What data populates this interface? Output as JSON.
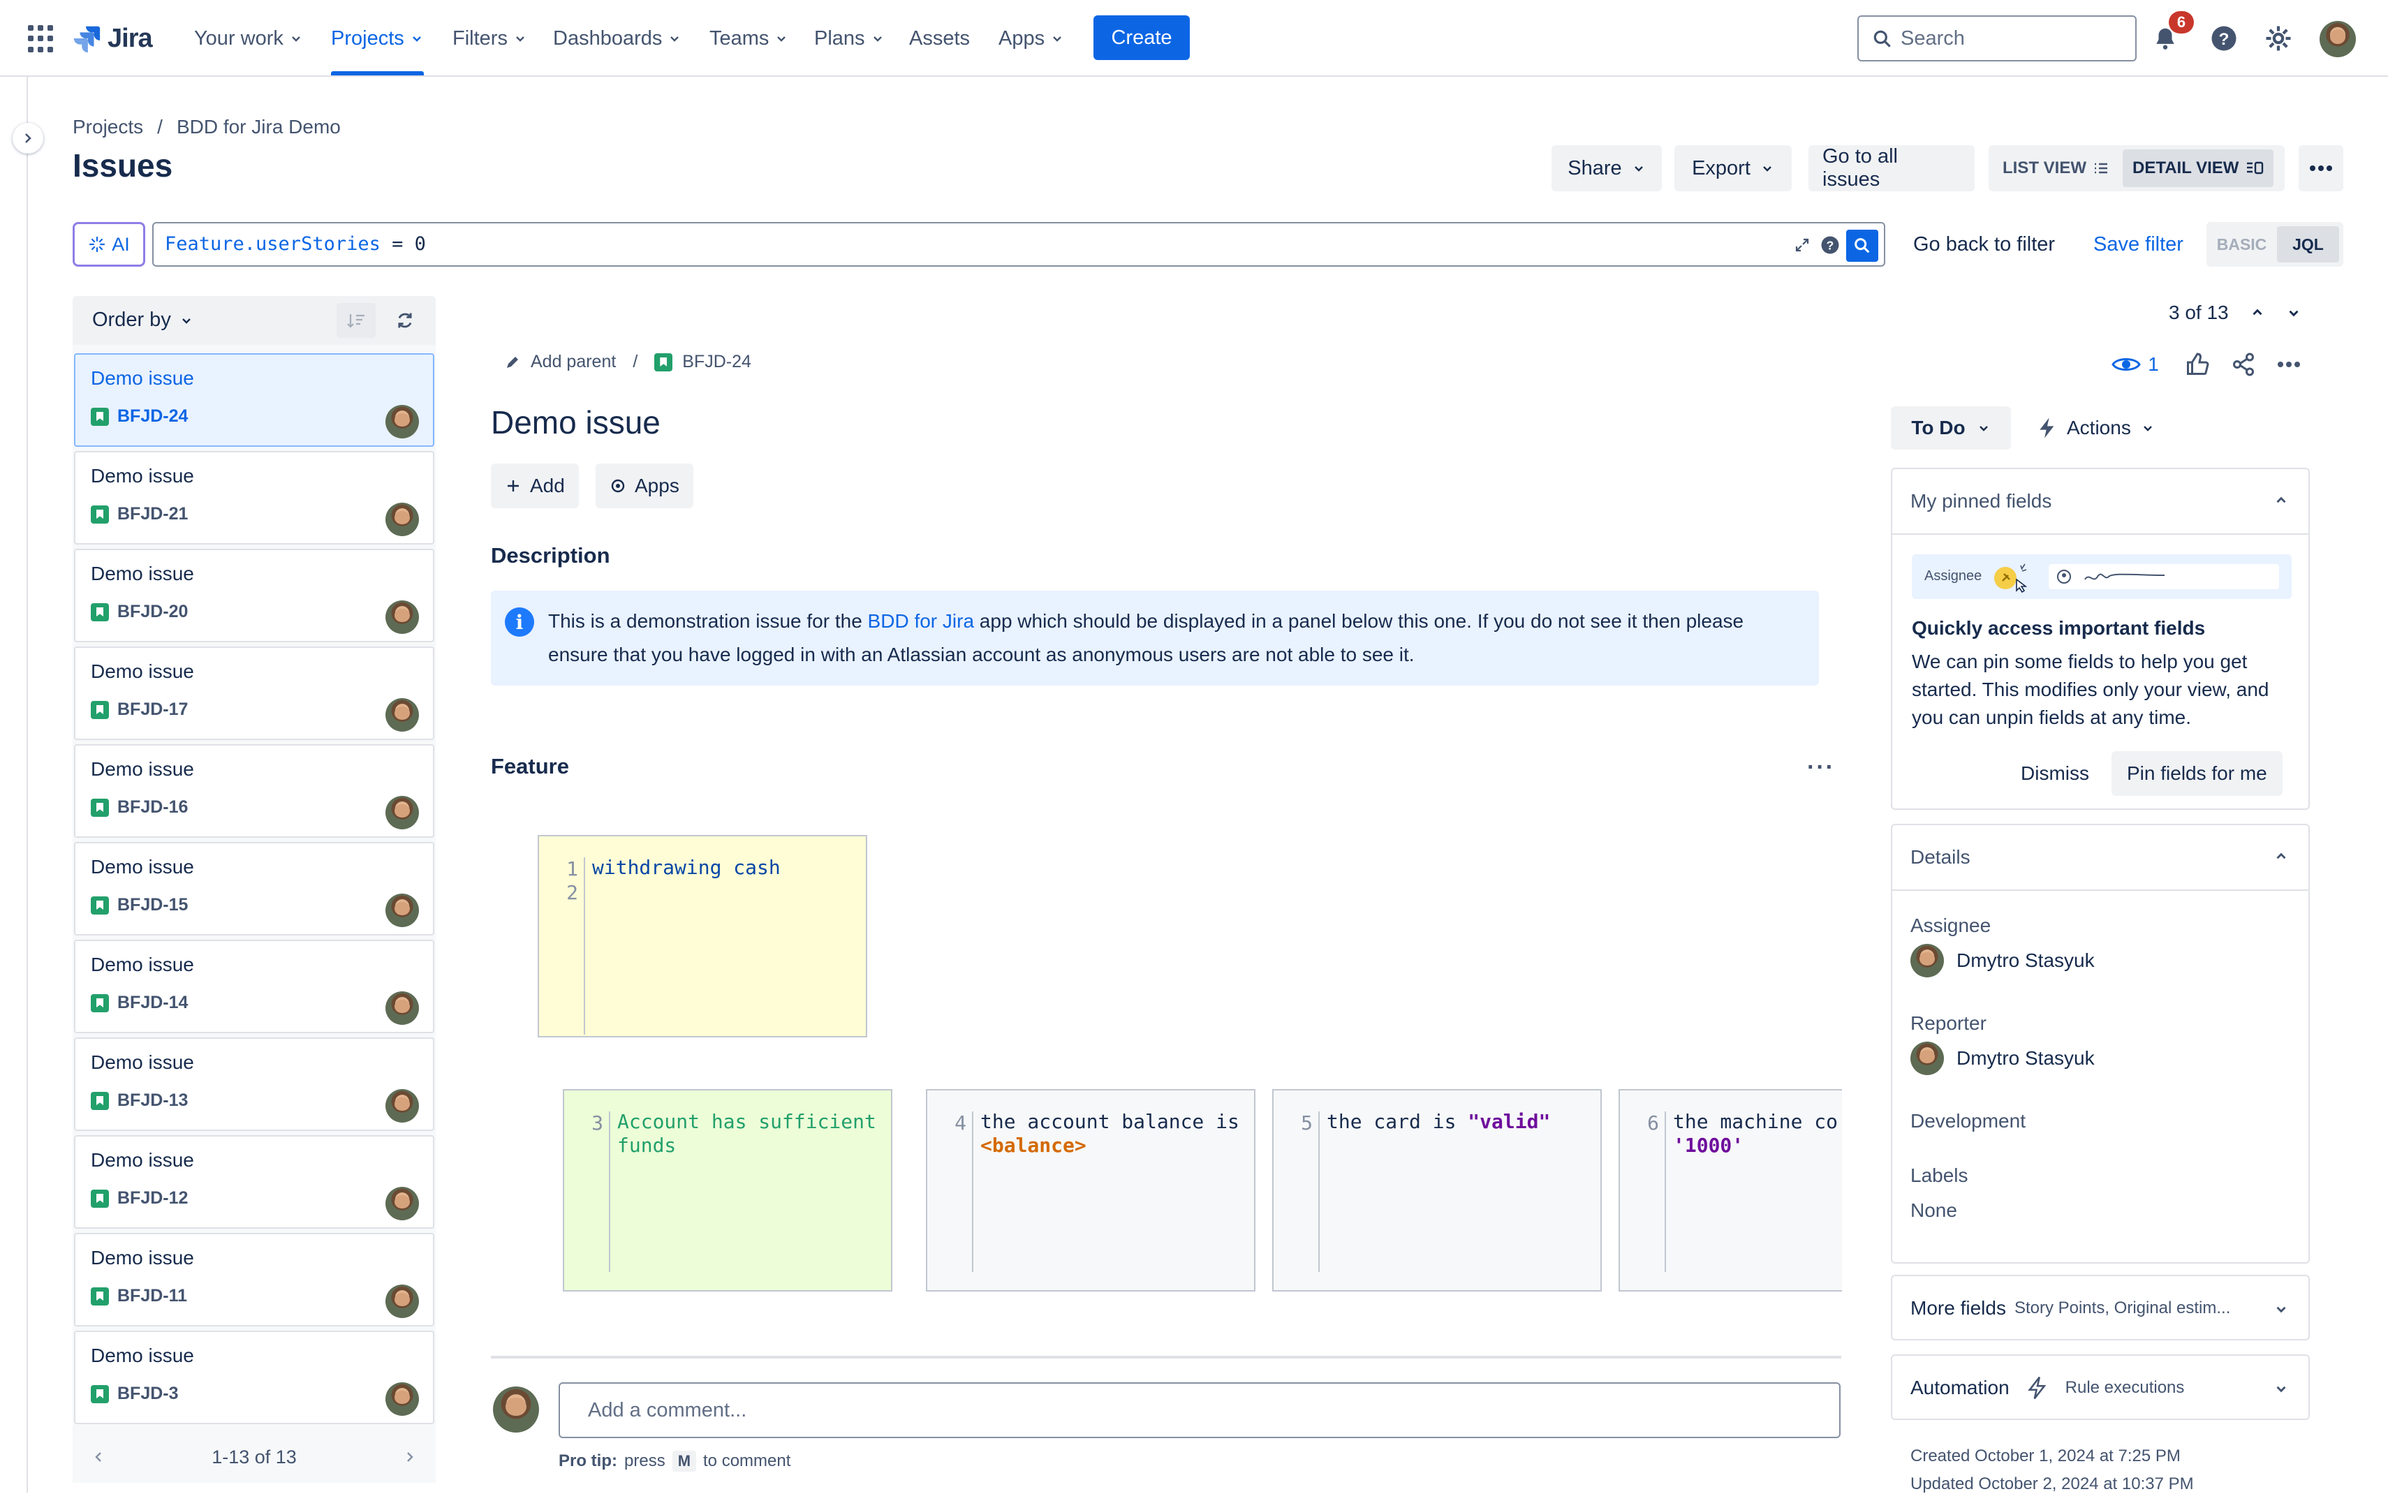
{
  "nav": {
    "logo": "Jira",
    "items": [
      {
        "label": "Your work"
      },
      {
        "label": "Projects"
      },
      {
        "label": "Filters"
      },
      {
        "label": "Dashboards"
      },
      {
        "label": "Teams"
      },
      {
        "label": "Plans"
      },
      {
        "label": "Assets"
      },
      {
        "label": "Apps"
      }
    ],
    "active": "Projects",
    "create_label": "Create",
    "search_placeholder": "Search",
    "notifications_count": "6",
    "accent": "#0c66e4"
  },
  "header": {
    "breadcrumb": [
      "Projects",
      "BDD for Jira Demo"
    ],
    "breadcrumb_sep": "/",
    "title": "Issues",
    "share_label": "Share",
    "export_label": "Export",
    "go_all_label": "Go to all issues",
    "list_view_label": "LIST VIEW",
    "detail_view_label": "DETAIL VIEW"
  },
  "jql": {
    "ai_label": "AI",
    "field": "Feature.userStories",
    "operator": "=",
    "value": "0",
    "back_label": "Go back to filter",
    "save_label": "Save filter",
    "basic_label": "BASIC",
    "jql_label": "JQL"
  },
  "list": {
    "order_label": "Order by",
    "cards": [
      {
        "title": "Demo issue",
        "key": "BFJD-24",
        "selected": true
      },
      {
        "title": "Demo issue",
        "key": "BFJD-21"
      },
      {
        "title": "Demo issue",
        "key": "BFJD-20"
      },
      {
        "title": "Demo issue",
        "key": "BFJD-17"
      },
      {
        "title": "Demo issue",
        "key": "BFJD-16"
      },
      {
        "title": "Demo issue",
        "key": "BFJD-15"
      },
      {
        "title": "Demo issue",
        "key": "BFJD-14"
      },
      {
        "title": "Demo issue",
        "key": "BFJD-13"
      },
      {
        "title": "Demo issue",
        "key": "BFJD-12"
      },
      {
        "title": "Demo issue",
        "key": "BFJD-11"
      },
      {
        "title": "Demo issue",
        "key": "BFJD-3"
      }
    ],
    "pagination": "1-13 of 13"
  },
  "issue": {
    "add_parent": "Add parent",
    "key": "BFJD-24",
    "title": "Demo issue",
    "add_label": "Add",
    "apps_label": "Apps",
    "description_heading": "Description",
    "description_before": "This is a demonstration issue for the ",
    "description_link": "BDD for Jira",
    "description_after": " app which should be displayed in a panel below this one. If you do not see it then please ensure that you have logged in with an Atlassian account as anonymous users are not able to see it.",
    "feature_heading": "Feature",
    "feature_title": "withdrawing cash",
    "blocks": [
      {
        "line": "3",
        "text": "Account has sufficient funds"
      },
      {
        "line": "4",
        "text": "the account balance is",
        "placeholder": "<balance>"
      },
      {
        "line": "5",
        "text": "the card is",
        "string": "\"valid\""
      },
      {
        "line": "6",
        "text": "the machine co",
        "string": "'1000'"
      }
    ],
    "comment_placeholder": "Add a comment...",
    "protip_label": "Pro tip:",
    "protip_press": "press",
    "protip_key": "M",
    "protip_rest": "to comment"
  },
  "side": {
    "counter": "3 of 13",
    "watchers": "1",
    "status": "To Do",
    "actions_label": "Actions",
    "pinned_heading": "My pinned fields",
    "pinned_illus_label": "Assignee",
    "pinned_title": "Quickly access important fields",
    "pinned_desc": "We can pin some fields to help you get started. This modifies only your view, and you can unpin fields at any time.",
    "dismiss_label": "Dismiss",
    "pin_label": "Pin fields for me",
    "details_heading": "Details",
    "assignee_label": "Assignee",
    "assignee": "Dmytro Stasyuk",
    "reporter_label": "Reporter",
    "reporter": "Dmytro Stasyuk",
    "development_label": "Development",
    "labels_label": "Labels",
    "labels_value": "None",
    "more_fields_label": "More fields",
    "more_fields_sub": "Story Points, Original estim...",
    "automation_label": "Automation",
    "automation_sub": "Rule executions",
    "created": "Created October 1, 2024 at 7:25 PM",
    "updated": "Updated October 2, 2024 at 10:37 PM"
  }
}
